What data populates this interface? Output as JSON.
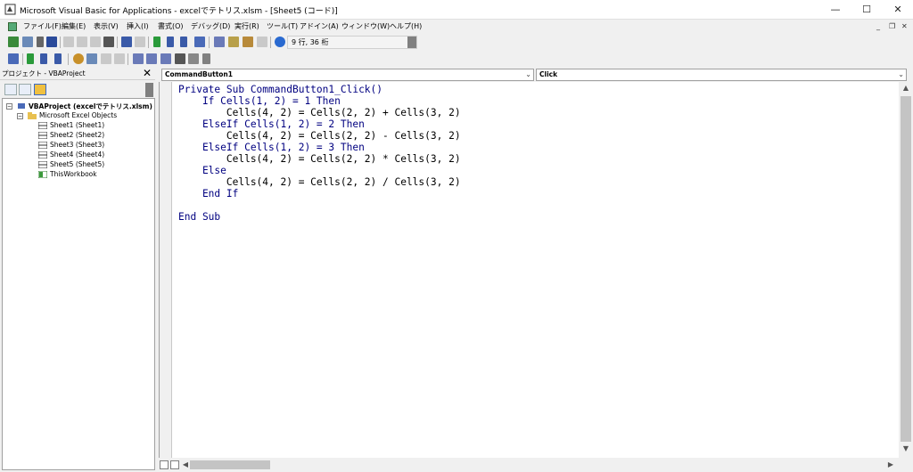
{
  "window": {
    "title": "Microsoft Visual Basic for Applications - excelでテトリス.xlsm - [Sheet5 (コード)]",
    "minimize": "—",
    "maximize": "☐",
    "close": "✕"
  },
  "menu": {
    "items": [
      "ファイル(F)",
      "編集(E)",
      "表示(V)",
      "挿入(I)",
      "書式(O)",
      "デバッグ(D)",
      "実行(R)",
      "ツール(T)",
      "アドイン(A)",
      "ウィンドウ(W)",
      "ヘルプ(H)"
    ],
    "mdi_minimize": "_",
    "mdi_restore": "❐",
    "mdi_close": "✕"
  },
  "toolbar": {
    "position": "9 行, 36 桁"
  },
  "project_explorer": {
    "title": "プロジェクト - VBAProject",
    "close": "✕",
    "tree": {
      "root": "VBAProject (excelでテトリス.xlsm)",
      "folder": "Microsoft Excel Objects",
      "items": [
        "Sheet1 (Sheet1)",
        "Sheet2 (Sheet2)",
        "Sheet3 (Sheet3)",
        "Sheet4 (Sheet4)",
        "Sheet5 (Sheet5)",
        "ThisWorkbook"
      ]
    }
  },
  "code_window": {
    "object_combo": "CommandButton1",
    "procedure_combo": "Click",
    "lines": [
      "Private Sub CommandButton1_Click()",
      "    If Cells(1, 2) = 1 Then",
      "        Cells(4, 2) = Cells(2, 2) + Cells(3, 2)",
      "    ElseIf Cells(1, 2) = 2 Then",
      "        Cells(4, 2) = Cells(2, 2) - Cells(3, 2)",
      "    ElseIf Cells(1, 2) = 3 Then",
      "        Cells(4, 2) = Cells(2, 2) * Cells(3, 2)",
      "    Else",
      "        Cells(4, 2) = Cells(2, 2) / Cells(3, 2)",
      "    End If",
      "",
      "End Sub"
    ]
  }
}
